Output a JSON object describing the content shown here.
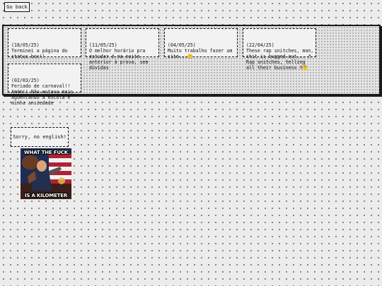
{
  "nav": {
    "back_label": "Go back"
  },
  "status_posts": [
    {
      "date": "(18/05/25)",
      "text": "Terminei a página do status box!!"
    },
    {
      "date": "(11/05/25)",
      "text": "O melhor horário pra estudar é na noite anterior à prova, sem dúvidas"
    },
    {
      "date": "(04/05/25)",
      "text": "Muito trabalho fazer um site...",
      "emoji": "🙂"
    },
    {
      "date": "(22/04/25)",
      "text": "These rap snitches, man, shit is bugged out... ♬ Rap snitches, telling all their business ♬",
      "emoji": "🤔"
    },
    {
      "date": "(02/03/25)",
      "text": "Feriado de carnaval!! Amém!! Não estava mais aguentando a escola e minha ansiedade"
    }
  ],
  "sidebar_note": "Sorry, no english!",
  "meme": {
    "top_text": "WHAT THE FUCK",
    "bottom_text": "IS A KILOMETER"
  },
  "colors": {
    "background": "#ececec",
    "panel": "#e4e4e4",
    "border": "#111111"
  }
}
